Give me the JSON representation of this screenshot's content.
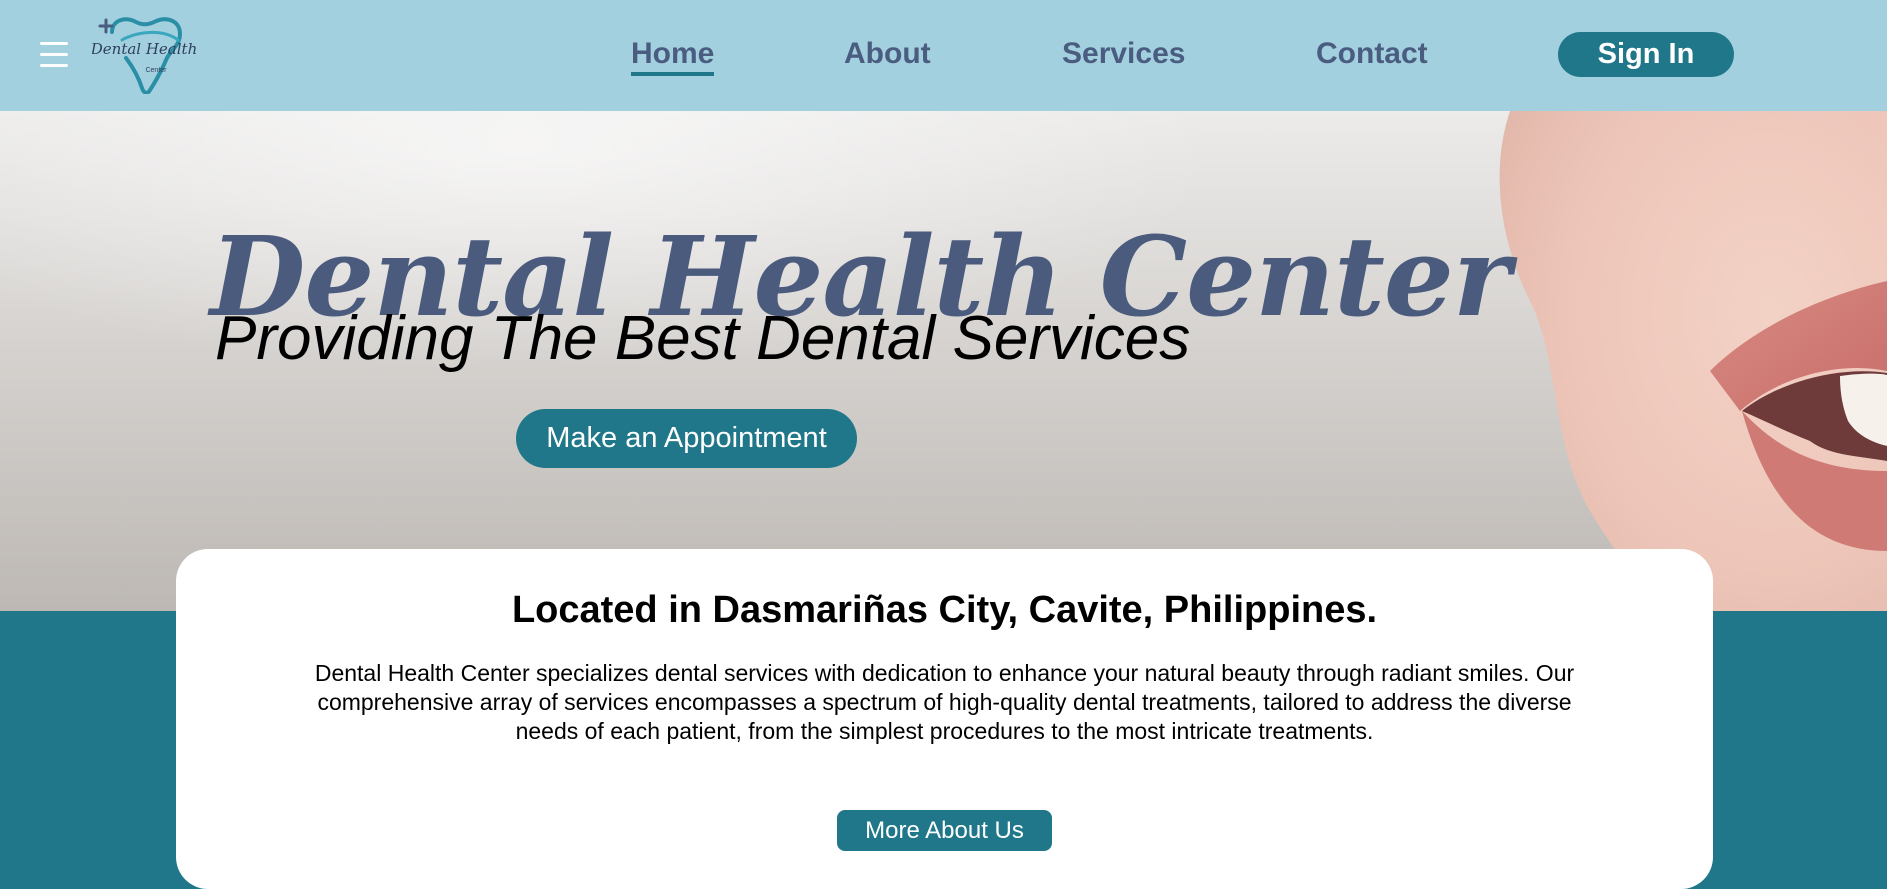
{
  "logo": {
    "line1": "Dental Health",
    "line2": "Center"
  },
  "nav": {
    "links": [
      {
        "label": "Home",
        "active": true
      },
      {
        "label": "About",
        "active": false
      },
      {
        "label": "Services",
        "active": false
      },
      {
        "label": "Contact",
        "active": false
      }
    ],
    "signin_label": "Sign In"
  },
  "hero": {
    "title": "Dental Health Center",
    "subtitle": "Providing The Best Dental Services",
    "cta_label": "Make an Appointment"
  },
  "about_card": {
    "heading": "Located in Dasmariñas City, Cavite, Philippines.",
    "body": "Dental Health Center specializes dental services with dedication to enhance your natural beauty through radiant smiles. Our comprehensive array of services encompasses a spectrum of high-quality dental treatments, tailored to address the diverse needs of each patient, from the simplest procedures to the most intricate treatments.",
    "button_label": "More About Us"
  },
  "colors": {
    "nav_bg": "#a3d0de",
    "accent": "#1f7789",
    "nav_text": "#4a5d80",
    "title_text": "#4a5b7d"
  },
  "icons": {
    "menu": "hamburger-menu-icon",
    "logo": "tooth-logo-icon"
  }
}
